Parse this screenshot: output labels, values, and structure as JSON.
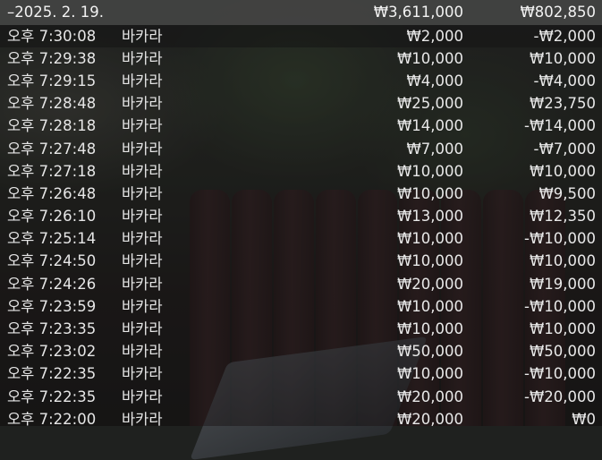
{
  "summary": {
    "date": "–2025. 2. 19.",
    "bet_total": "₩3,611,000",
    "win_total": "₩802,850"
  },
  "rows": [
    {
      "time": "오후 7:30:08",
      "game": "바카라",
      "bet": "₩2,000",
      "win": "-₩2,000"
    },
    {
      "time": "오후 7:29:38",
      "game": "바카라",
      "bet": "₩10,000",
      "win": "₩10,000"
    },
    {
      "time": "오후 7:29:15",
      "game": "바카라",
      "bet": "₩4,000",
      "win": "-₩4,000"
    },
    {
      "time": "오후 7:28:48",
      "game": "바카라",
      "bet": "₩25,000",
      "win": "₩23,750"
    },
    {
      "time": "오후 7:28:18",
      "game": "바카라",
      "bet": "₩14,000",
      "win": "-₩14,000"
    },
    {
      "time": "오후 7:27:48",
      "game": "바카라",
      "bet": "₩7,000",
      "win": "-₩7,000"
    },
    {
      "time": "오후 7:27:18",
      "game": "바카라",
      "bet": "₩10,000",
      "win": "₩10,000"
    },
    {
      "time": "오후 7:26:48",
      "game": "바카라",
      "bet": "₩10,000",
      "win": "₩9,500"
    },
    {
      "time": "오후 7:26:10",
      "game": "바카라",
      "bet": "₩13,000",
      "win": "₩12,350"
    },
    {
      "time": "오후 7:25:14",
      "game": "바카라",
      "bet": "₩10,000",
      "win": "-₩10,000"
    },
    {
      "time": "오후 7:24:50",
      "game": "바카라",
      "bet": "₩10,000",
      "win": "₩10,000"
    },
    {
      "time": "오후 7:24:26",
      "game": "바카라",
      "bet": "₩20,000",
      "win": "₩19,000"
    },
    {
      "time": "오후 7:23:59",
      "game": "바카라",
      "bet": "₩10,000",
      "win": "-₩10,000"
    },
    {
      "time": "오후 7:23:35",
      "game": "바카라",
      "bet": "₩10,000",
      "win": "₩10,000"
    },
    {
      "time": "오후 7:23:02",
      "game": "바카라",
      "bet": "₩50,000",
      "win": "₩50,000"
    },
    {
      "time": "오후 7:22:35",
      "game": "바카라",
      "bet": "₩10,000",
      "win": "-₩10,000"
    },
    {
      "time": "오후 7:22:35",
      "game": "바카라",
      "bet": "₩20,000",
      "win": "-₩20,000"
    },
    {
      "time": "오후 7:22:00",
      "game": "바카라",
      "bet": "₩20,000",
      "win": "₩0"
    }
  ]
}
